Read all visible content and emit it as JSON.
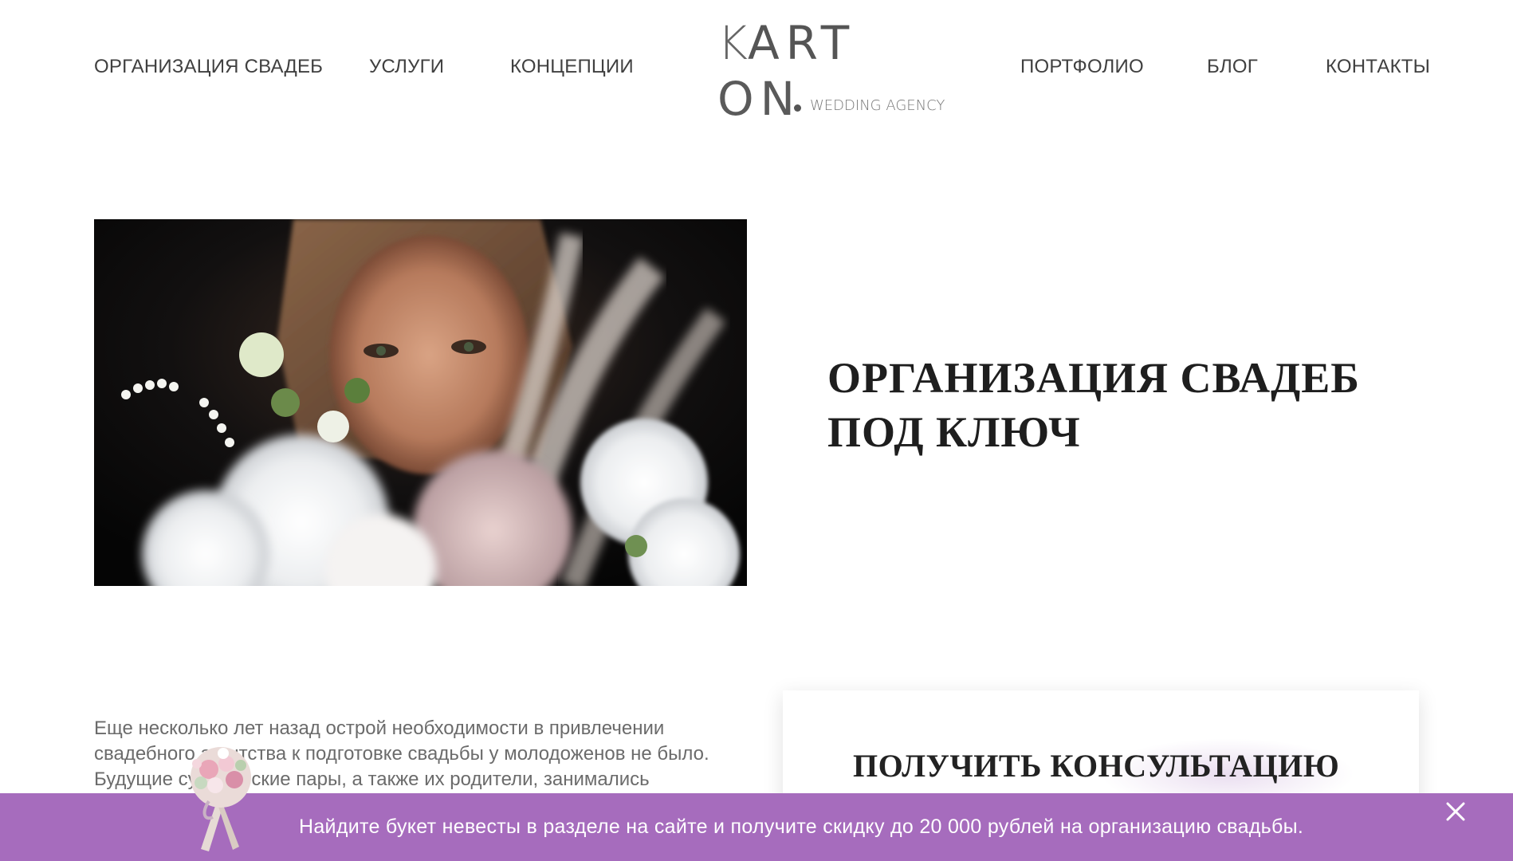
{
  "nav": {
    "left": [
      {
        "label": "ОРГАНИЗАЦИЯ СВАДЕБ"
      },
      {
        "label": "УСЛУГИ"
      },
      {
        "label": "КОНЦЕПЦИИ"
      }
    ],
    "right": [
      {
        "label": "ПОРТФОЛИО"
      },
      {
        "label": "БЛОГ"
      },
      {
        "label": "КОНТАКТЫ"
      }
    ]
  },
  "logo": {
    "k": "K",
    "art": "ART",
    "on": "ON",
    "sub": "WEDDING AGENCY"
  },
  "hero": {
    "title_line1": "ОРГАНИЗАЦИЯ СВАДЕБ",
    "title_line2": "ПОД КЛЮЧ"
  },
  "intro": {
    "text": "Еще несколько лет назад острой необходимости в привлечении свадебного агентства к подготовке свадьбы у молодоженов не было. Будущие супружеские пары, а также их родители, занимались"
  },
  "consultation": {
    "title": "ПОЛУЧИТЬ КОНСУЛЬТАЦИЮ ЭКСПЕРТА"
  },
  "banner": {
    "text": "Найдите букет невесты в разделе на сайте и получите скидку до 20 000 рублей на организацию свадьбы.",
    "color": "#a66cbd"
  }
}
